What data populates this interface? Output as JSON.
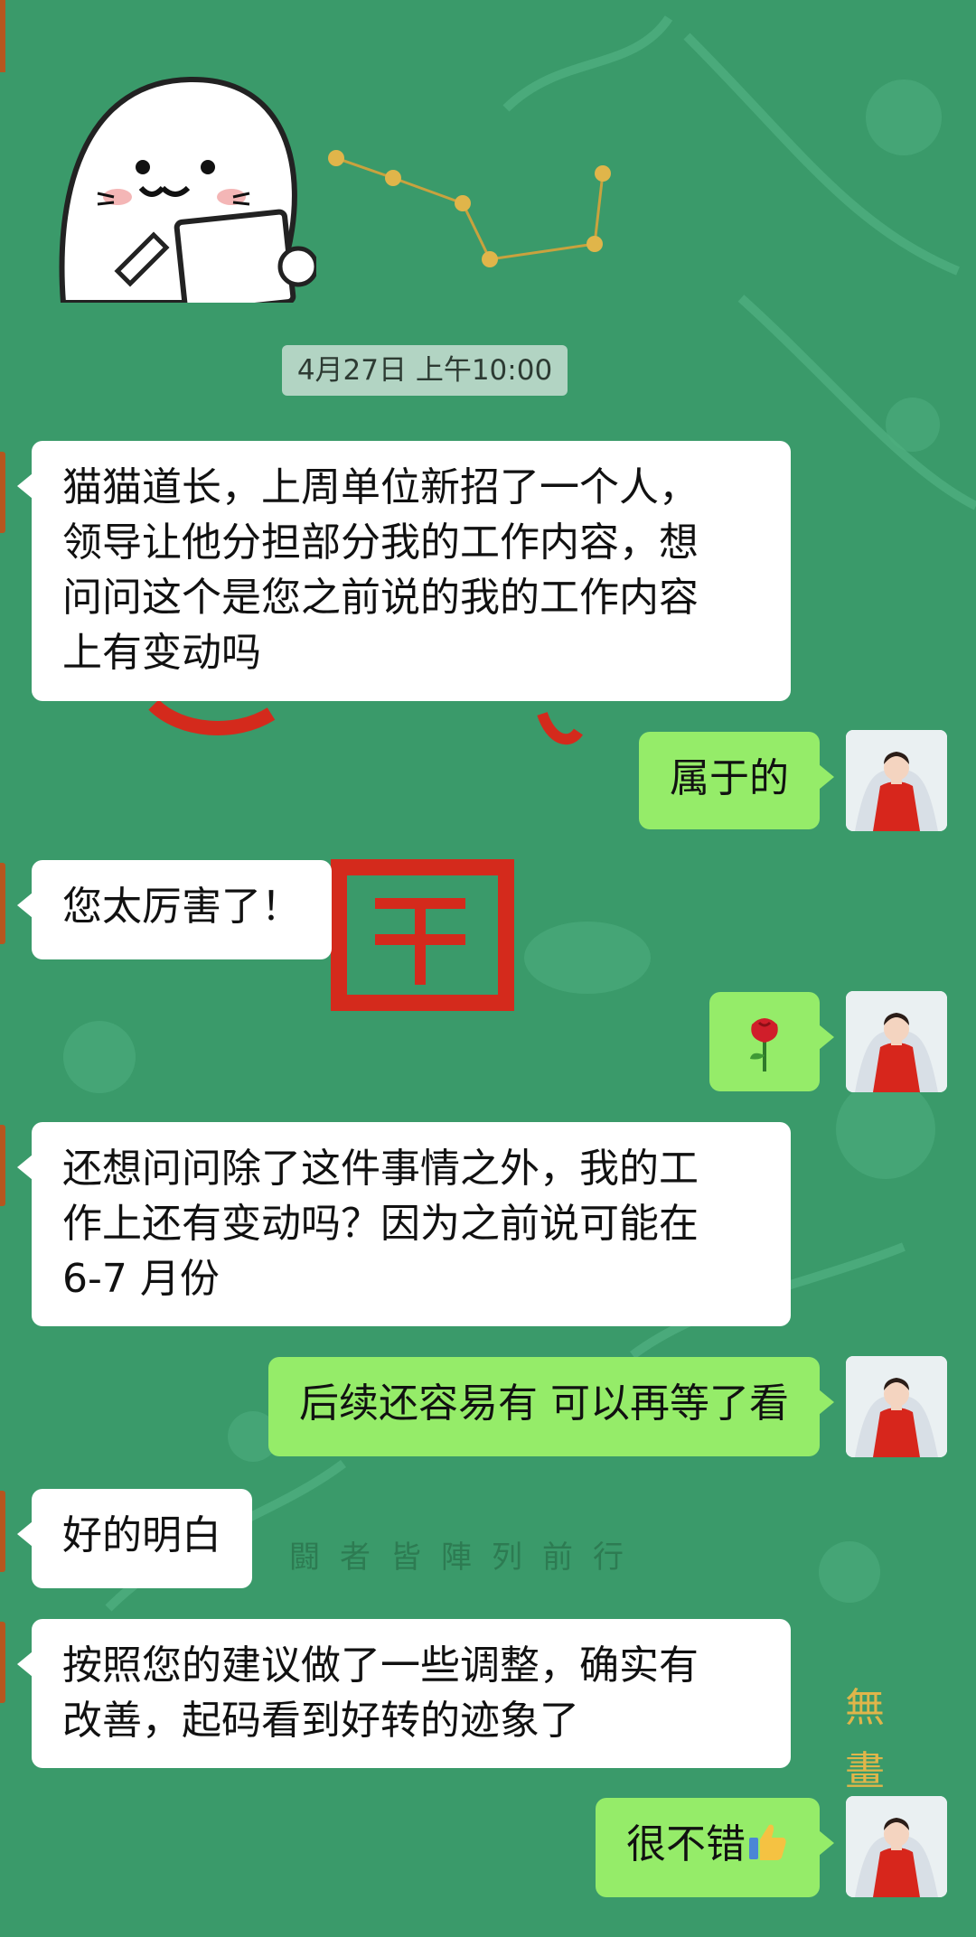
{
  "chat": {
    "timestamp": "4月27日 上午10:00",
    "messages": [
      {
        "side": "left",
        "text": "猫猫道长，上周单位新招了一个人，领导让他分担部分我的工作内容，想问问这个是您之前说的我的工作内容上有变动吗"
      },
      {
        "side": "right",
        "text": "属于的"
      },
      {
        "side": "left",
        "text": "您太厉害了！"
      },
      {
        "side": "right",
        "emoji": "rose-icon"
      },
      {
        "side": "left",
        "text": "还想问问除了这件事情之外，我的工作上还有变动吗？因为之前说可能在6-7月份"
      },
      {
        "side": "right",
        "text": "后续还容易有 可以再等了看"
      },
      {
        "side": "left",
        "text": "好的明白"
      },
      {
        "side": "left",
        "text": "按照您的建议做了一些调整，确实有改善，起码看到好转的迹象了"
      },
      {
        "side": "right",
        "text": "很不错",
        "emoji": "thumbs-up-icon"
      }
    ],
    "lines": {
      "m1": [
        "猫猫道长，上周单位新招了一个人，",
        "领导让他分担部分我的工作内容，想",
        "问问这个是您之前说的我的工作内容",
        "上有变动吗"
      ],
      "m5": [
        "还想问问除了这件事情之外，我的工",
        "作上还有变动吗？因为之前说可能在",
        "6-7 月份"
      ],
      "m8": [
        "按照您的建议做了一些调整，确实有",
        "改善，起码看到好转的迹象了"
      ]
    }
  },
  "background": {
    "text": "闘者皆陣列前行",
    "colors": {
      "base": "#3a9a6a",
      "pattern": "#4fae80",
      "red": "#d42a1c",
      "gold": "#e0b54a"
    }
  },
  "colors": {
    "bubble_left": "#ffffff",
    "bubble_right": "#95ec69",
    "text": "#111111"
  }
}
